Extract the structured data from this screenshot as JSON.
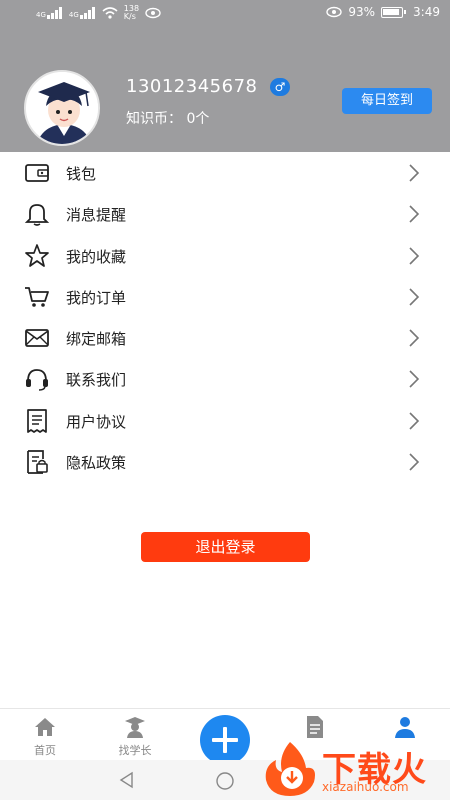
{
  "status_bar": {
    "net1": "4G",
    "net2": "4G",
    "speed_value": "138",
    "speed_unit": "K/s",
    "battery": "93%",
    "time": "3:49"
  },
  "profile": {
    "phone": "13012345678",
    "gender_symbol": "♂",
    "coins_label": "知识币：",
    "coins_value": "0个",
    "checkin_label": "每日签到"
  },
  "menu": {
    "items": [
      {
        "label": "钱包",
        "icon": "wallet-icon"
      },
      {
        "label": "消息提醒",
        "icon": "bell-icon"
      },
      {
        "label": "我的收藏",
        "icon": "star-icon"
      },
      {
        "label": "我的订单",
        "icon": "cart-icon"
      },
      {
        "label": "绑定邮箱",
        "icon": "envelope-icon"
      },
      {
        "label": "联系我们",
        "icon": "headset-icon"
      },
      {
        "label": "用户协议",
        "icon": "document-icon"
      },
      {
        "label": "隐私政策",
        "icon": "policy-icon"
      }
    ]
  },
  "logout_label": "退出登录",
  "bottom_nav": {
    "home": "首页",
    "senior": "找学长",
    "plus_icon": "plus-icon"
  },
  "watermark": {
    "text": "下载火",
    "url": "xiazaihuo.com"
  },
  "colors": {
    "header_bg": "#9d9d9f",
    "accent_blue": "#2c8af0",
    "logout_red": "#ff3b0f"
  }
}
